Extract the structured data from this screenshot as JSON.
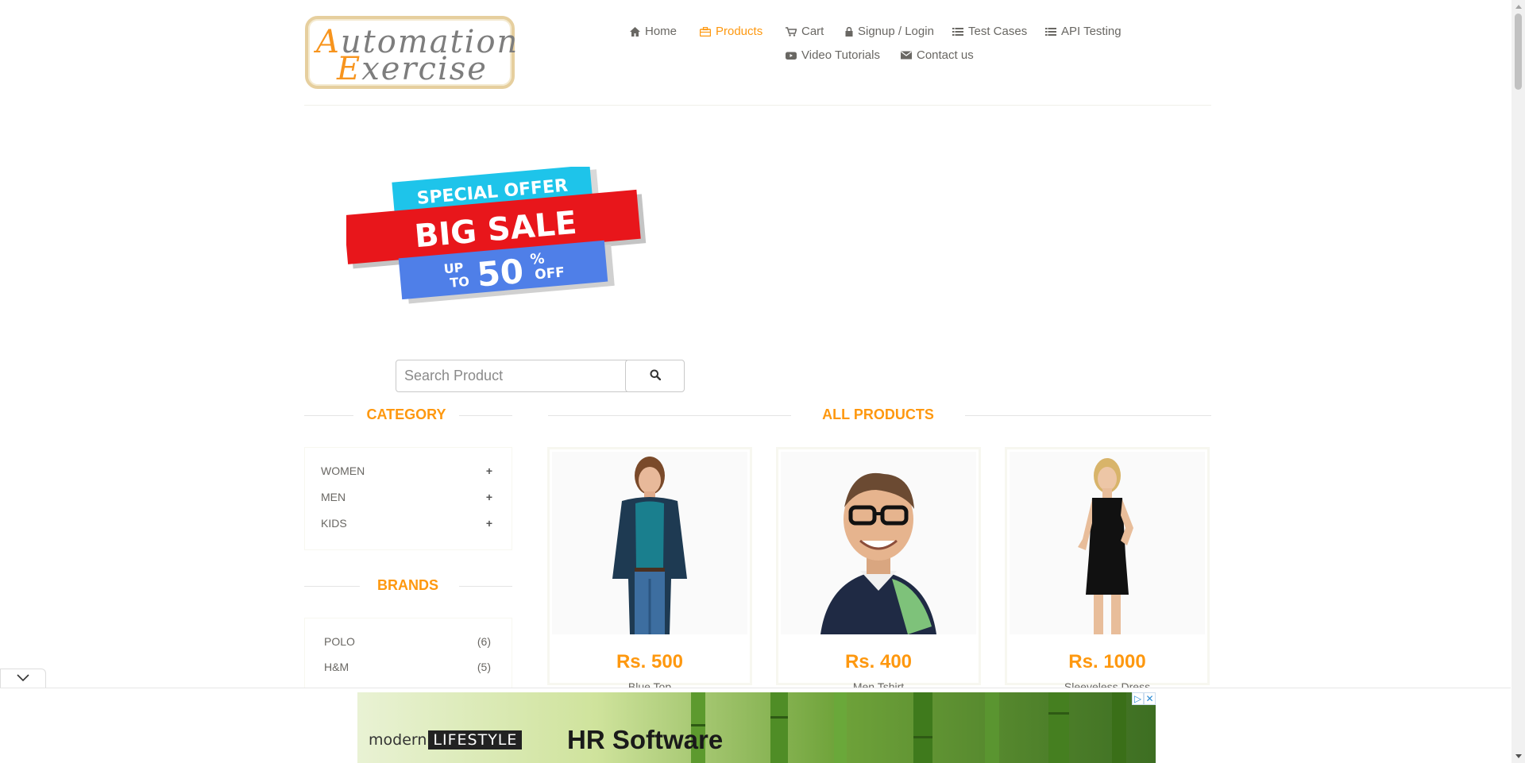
{
  "logo": {
    "line1_first": "A",
    "line1_rest": "utomation",
    "line2_first": "E",
    "line2_rest": "xercise"
  },
  "nav": {
    "home": "Home",
    "products": "Products",
    "cart": "Cart",
    "login": "Signup / Login",
    "test_cases": "Test Cases",
    "api_testing": "API Testing",
    "video_tutorials": "Video Tutorials",
    "contact": "Contact us"
  },
  "banner": {
    "line1": "SPECIAL OFFER",
    "line2": "BIG SALE",
    "up": "UP",
    "to": "TO",
    "percent": "50",
    "pct_sign": "%",
    "off": "OFF"
  },
  "search": {
    "placeholder": "Search Product",
    "value": ""
  },
  "sidebar": {
    "category_title": "CATEGORY",
    "categories": [
      {
        "label": "WOMEN",
        "toggle": "+"
      },
      {
        "label": "MEN",
        "toggle": "+"
      },
      {
        "label": "KIDS",
        "toggle": "+"
      }
    ],
    "brands_title": "BRANDS",
    "brands": [
      {
        "label": "POLO",
        "count": "(6)"
      },
      {
        "label": "H&M",
        "count": "(5)"
      }
    ]
  },
  "main": {
    "title": "ALL PRODUCTS",
    "products": [
      {
        "price": "Rs. 500",
        "name": "Blue Top"
      },
      {
        "price": "Rs. 400",
        "name": "Men Tshirt"
      },
      {
        "price": "Rs. 1000",
        "name": "Sleeveless Dress"
      }
    ]
  },
  "ad": {
    "brand_prefix": "modern",
    "brand_box": "LIFESTYLE",
    "headline": "HR Software",
    "info_icon": "▷",
    "close_icon": "✕"
  },
  "colors": {
    "accent": "#fe980f",
    "text": "#696763",
    "sale_red": "#e8161b",
    "sale_cyan": "#1ec4ea",
    "sale_blue": "#4f7fe8"
  },
  "icons": {
    "home": "home-icon",
    "products": "products-icon",
    "cart": "cart-icon",
    "login": "lock-icon",
    "test_cases": "list-icon",
    "api_testing": "list-icon",
    "video": "youtube-icon",
    "contact": "envelope-icon",
    "search": "search-icon"
  }
}
